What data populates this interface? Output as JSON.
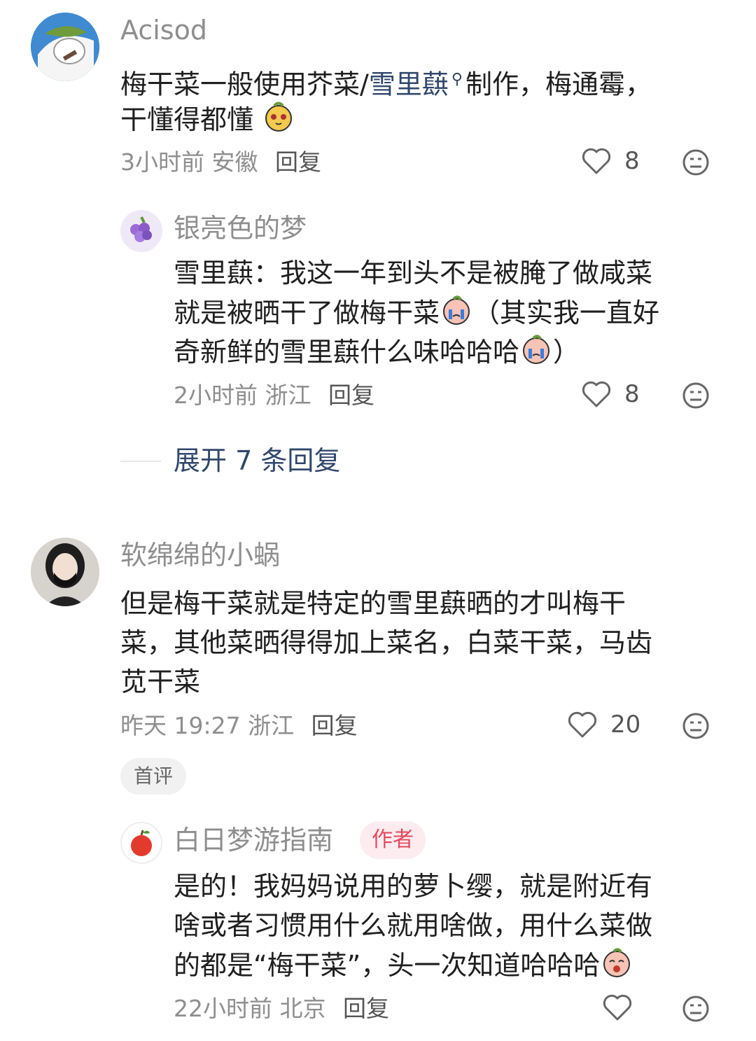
{
  "comments": [
    {
      "user": "Acisod",
      "text_line1_before": "梅干菜一般使用芥菜/",
      "text_line1_link": "雪里蕻",
      "text_line1_after": "制作，梅通霉，",
      "text_line2": "干懂得都懂",
      "time": "3小时前",
      "location": "安徽",
      "reply": "回复",
      "likes": "8"
    },
    {
      "user": "银亮色的梦",
      "line1": "雪里蕻：我这一年到头不是被腌了做咸菜",
      "line2": "就是被晒干了做梅干菜",
      "line2_after": "（其实我一直好",
      "line3": "奇新鲜的雪里蕻什么味哈哈哈",
      "line3_after": "）",
      "time": "2小时前",
      "location": "浙江",
      "reply": "回复",
      "likes": "8"
    },
    {
      "user": "软绵绵的小蜗",
      "line1": "但是梅干菜就是特定的雪里蕻晒的才叫梅干",
      "line2": "菜，其他菜晒得得加上菜名，白菜干菜，马齿",
      "line3": "苋干菜",
      "time": "昨天 19:27",
      "location": "浙江",
      "reply": "回复",
      "likes": "20",
      "badge": "首评"
    },
    {
      "user": "白日梦游指南",
      "author_badge": "作者",
      "line1": "是的！我妈妈说用的萝卜缨，就是附近有",
      "line2": "啥或者习惯用什么就用啥做，用什么菜做",
      "line3": "的都是“梅干菜”，头一次知道哈哈哈",
      "time": "22小时前",
      "location": "北京",
      "reply": "回复"
    }
  ],
  "expand_replies": "展开 7 条回复",
  "icons": {
    "like": "heart-outline-icon",
    "dislike": "neutral-face-icon",
    "search": "search-icon"
  },
  "colors": {
    "link": "#31476b",
    "author_badge": "#e14b5e"
  }
}
